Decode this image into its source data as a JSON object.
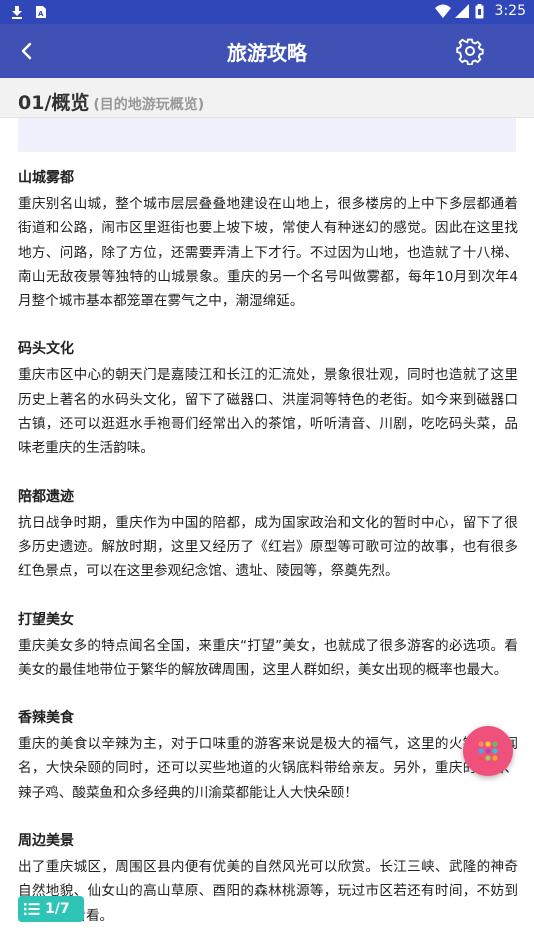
{
  "status_bar": {
    "time": "3:25"
  },
  "app_bar": {
    "title": "旅游攻略"
  },
  "section": {
    "number_title": "01/概览",
    "subtitle": "(目的地游玩概览)"
  },
  "articles": [
    {
      "title": "山城雾都",
      "body": "重庆别名山城，整个城市层层叠叠地建设在山地上，很多楼房的上中下多层都通着街道和公路，闹市区里逛街也要上坡下坡，常使人有种迷幻的感觉。因此在这里找地方、问路，除了方位，还需要弄清上下才行。不过因为山地，也造就了十八梯、南山无敌夜景等独特的山城景象。重庆的另一个名号叫做雾都，每年10月到次年4月整个城市基本都笼罩在雾气之中，潮湿绵延。"
    },
    {
      "title": "码头文化",
      "body": "重庆市区中心的朝天门是嘉陵江和长江的汇流处，景象很壮观，同时也造就了这里历史上著名的水码头文化，留下了磁器口、洪崖洞等特色的老街。如今来到磁器口古镇，还可以逛逛水手袍哥们经常出入的茶馆，听听清音、川剧，吃吃码头菜，品味老重庆的生活韵味。"
    },
    {
      "title": "陪都遗迹",
      "body": "抗日战争时期，重庆作为中国的陪都，成为国家政治和文化的暂时中心，留下了很多历史遗迹。解放时期，这里又经历了《红岩》原型等可歌可泣的故事，也有很多红色景点，可以在这里参观纪念馆、遗址、陵园等，祭奠先烈。"
    },
    {
      "title": "打望美女",
      "body": "重庆美女多的特点闻名全国，来重庆“打望”美女，也就成了很多游客的必选项。看美女的最佳地带位于繁华的解放碑周围，这里人群如织，美女出现的概率也最大。"
    },
    {
      "title": "香辣美食",
      "body": "重庆的美食以辛辣为主，对于口味重的游客来说是极大的福气，这里的火锅更是闻名，大快朵颐的同时，还可以买些地道的火锅底料带给亲友。另外，重庆的小面、辣子鸡、酸菜鱼和众多经典的川渝菜都能让人大快朵颐！"
    },
    {
      "title": "周边美景",
      "body": "出了重庆城区，周围区县内便有优美的自然风光可以欣赏。长江三峡、武隆的神奇自然地貌、仙女山的高山草原、酉阳的森林桃源等，玩过市区若还有时间，不妨到周边走走看看。"
    }
  ],
  "pager": {
    "label": "1/7"
  },
  "colors": {
    "status_bar": "#2f47b8",
    "app_bar": "#3f51b5",
    "fab": "#f0517c",
    "pager": "#2ec4b6"
  },
  "icons": [
    "download-icon",
    "sim-icon",
    "wifi-icon",
    "signal-icon",
    "battery-icon",
    "back-arrow-icon",
    "gear-icon",
    "grid-dots-icon",
    "list-icon"
  ]
}
